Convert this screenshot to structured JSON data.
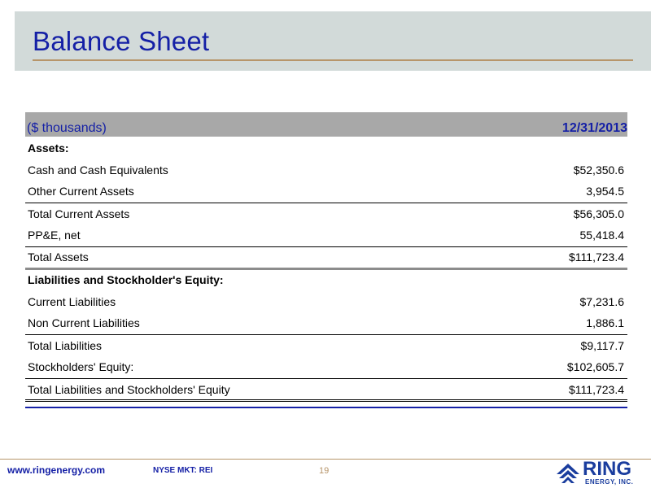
{
  "header": {
    "title": "Balance Sheet"
  },
  "table": {
    "unit_label": "($ thousands)",
    "date_label": "12/31/2013",
    "rows": [
      {
        "label": "Assets:",
        "value": ""
      },
      {
        "label": "Cash and Cash Equivalents",
        "value": "$52,350.6"
      },
      {
        "label": "Other Current Assets",
        "value": "3,954.5"
      },
      {
        "label": "Total Current Assets",
        "value": "$56,305.0"
      },
      {
        "label": "PP&E, net",
        "value": "55,418.4"
      },
      {
        "label": "Total Assets",
        "value": "$111,723.4"
      },
      {
        "label": "Liabilities and Stockholder's Equity:",
        "value": ""
      },
      {
        "label": "Current Liabilities",
        "value": "$7,231.6"
      },
      {
        "label": "Non Current Liabilities",
        "value": "1,886.1"
      },
      {
        "label": "Total Liabilities",
        "value": "$9,117.7"
      },
      {
        "label": "Stockholders' Equity:",
        "value": "$102,605.7"
      },
      {
        "label": "Total Liabilities and Stockholders' Equity",
        "value": "$111,723.4"
      }
    ]
  },
  "footer": {
    "url": "www.ringenergy.com",
    "ticker": "NYSE MKT: REI",
    "page_number": "19"
  },
  "logo": {
    "word": "RING",
    "subtitle": "ENERGY, INC.",
    "color": "#1a3d9e"
  },
  "colors": {
    "title_blue": "#1520a6",
    "accent_tan": "#b7956a",
    "header_gray": "#a8a8a8",
    "band_gray": "#d2dad9"
  }
}
